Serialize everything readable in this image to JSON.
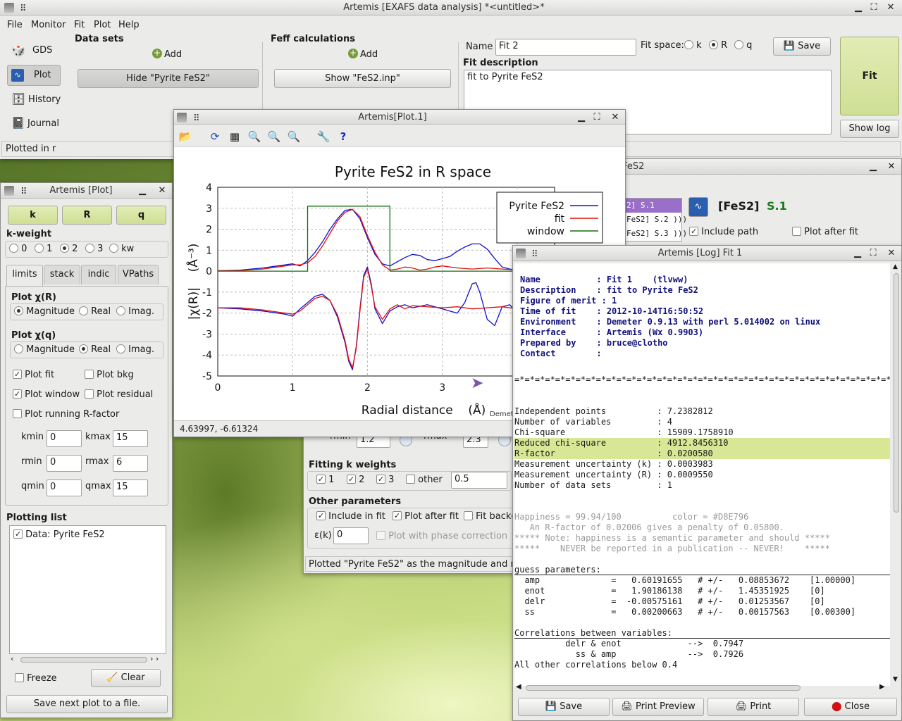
{
  "main": {
    "title": "Artemis [EXAFS data analysis] *<untitled>*",
    "menu": [
      "File",
      "Monitor",
      "Fit",
      "Plot",
      "Help"
    ],
    "side": [
      "GDS",
      "Plot",
      "History",
      "Journal"
    ],
    "data_sets_label": "Data sets",
    "add": "Add",
    "hide_btn": "Hide \"Pyrite FeS2\"",
    "feff_label": "Feff calculations",
    "show_btn": "Show \"FeS2.inp\"",
    "name_label": "Name",
    "name_value": "Fit 2",
    "fitspace_label": "Fit space:",
    "fitspace_opts": [
      "k",
      "R",
      "q"
    ],
    "save": "Save",
    "fit_btn": "Fit",
    "desc_label": "Fit description",
    "desc_value": "fit to Pyrite FeS2",
    "showlog": "Show log",
    "status": "Plotted in r"
  },
  "plotctl": {
    "title": "Artemis [Plot]",
    "kbtn": "k",
    "rbtn": "R",
    "qbtn": "q",
    "kweight_label": "k-weight",
    "kweights": [
      "0",
      "1",
      "2",
      "3",
      "kw"
    ],
    "tabs": [
      "limits",
      "stack",
      "indic",
      "VPaths"
    ],
    "plot_r_label": "Plot χ(R)",
    "plot_r_opts": [
      "Magnitude",
      "Real",
      "Imag."
    ],
    "plot_q_label": "Plot χ(q)",
    "plot_q_opts": [
      "Magnitude",
      "Real",
      "Imag."
    ],
    "plotfit": "Plot fit",
    "plotbkg": "Plot bkg",
    "plotwindow": "Plot window",
    "plotresid": "Plot residual",
    "plotrunning": "Plot running R-factor",
    "kmin_l": "kmin",
    "kmin": "0",
    "kmax_l": "kmax",
    "kmax": "15",
    "rmin_l": "rmin",
    "rmin": "0",
    "rmax_l": "rmax",
    "rmax": "6",
    "qmin_l": "qmin",
    "qmin": "0",
    "qmax_l": "qmax",
    "qmax": "15",
    "plotlist_label": "Plotting list",
    "plotlist_item": "Data: Pyrite FeS2",
    "freeze": "Freeze",
    "clear": "Clear",
    "savenext": "Save next plot to a file."
  },
  "plot1": {
    "title": "Artemis[Plot.1]",
    "coords": "4.63997, -6.61324"
  },
  "chart_data": {
    "type": "line",
    "title": "Pyrite FeS2 in R space",
    "xlabel": "Radial distance    (Å)",
    "ylabel": "|χ(R)|    (Å⁻³)",
    "xlim": [
      0,
      4.5
    ],
    "ylim": [
      -5,
      4
    ],
    "xticks": [
      "0",
      "1",
      "2",
      "3",
      "4"
    ],
    "yticks": [
      "4",
      "3",
      "2",
      "1",
      "0",
      "-1",
      "-2",
      "-3",
      "-4",
      "-5"
    ],
    "grid": true,
    "legend_position": "top-right",
    "footer": "Demete",
    "series": [
      {
        "name": "Pyrite FeS2",
        "color": "#1010d0",
        "x": [
          0,
          0.3,
          0.6,
          0.9,
          1.0,
          1.1,
          1.2,
          1.3,
          1.4,
          1.5,
          1.6,
          1.7,
          1.8,
          1.9,
          2.0,
          2.1,
          2.2,
          2.3,
          2.4,
          2.5,
          2.6,
          2.7,
          2.8,
          2.9,
          3.0,
          3.1,
          3.2,
          3.3,
          3.4,
          3.5,
          3.6,
          3.7,
          3.8,
          3.9,
          4.0,
          4.1,
          4.2,
          4.3,
          4.5
        ],
        "y": [
          0.02,
          0.05,
          0.15,
          0.3,
          0.35,
          0.25,
          0.5,
          0.9,
          1.4,
          2.0,
          2.5,
          2.9,
          2.95,
          2.5,
          1.6,
          0.8,
          0.35,
          0.25,
          0.45,
          0.65,
          0.8,
          0.75,
          0.55,
          0.5,
          0.6,
          0.7,
          0.95,
          1.15,
          1.3,
          1.3,
          1.05,
          0.6,
          0.2,
          0.1,
          0.05,
          0.05,
          0.03,
          0.02,
          0.01
        ]
      },
      {
        "name": "fit",
        "color": "#e01010",
        "x": [
          0,
          0.3,
          0.6,
          0.9,
          1.0,
          1.1,
          1.2,
          1.3,
          1.4,
          1.5,
          1.6,
          1.7,
          1.8,
          1.9,
          2.0,
          2.1,
          2.2,
          2.3,
          2.4,
          2.5,
          2.6,
          2.7,
          2.8,
          2.9,
          3.0,
          3.2,
          3.4,
          3.6,
          3.8,
          4.0,
          4.2,
          4.5
        ],
        "y": [
          0.02,
          0.03,
          0.1,
          0.25,
          0.3,
          0.3,
          0.4,
          0.7,
          1.2,
          1.8,
          2.4,
          2.8,
          2.95,
          2.6,
          1.7,
          0.9,
          0.3,
          0.05,
          0.1,
          0.2,
          0.15,
          0.05,
          0.1,
          0.2,
          0.25,
          0.15,
          0.1,
          0.15,
          0.1,
          0.05,
          0.05,
          0.03
        ]
      },
      {
        "name": "window",
        "color": "#107010",
        "x": [
          0,
          1.2,
          1.2,
          2.3,
          2.3,
          4.5
        ],
        "y": [
          0,
          0,
          3.1,
          3.1,
          0,
          0
        ]
      },
      {
        "name": "",
        "color": "#1010d0",
        "x": [
          0,
          0.3,
          0.6,
          0.9,
          1.0,
          1.1,
          1.2,
          1.3,
          1.4,
          1.5,
          1.6,
          1.7,
          1.75,
          1.8,
          1.85,
          1.9,
          1.95,
          2.0,
          2.05,
          2.1,
          2.2,
          2.3,
          2.4,
          2.5,
          2.6,
          2.8,
          3.0,
          3.1,
          3.2,
          3.3,
          3.4,
          3.45,
          3.5,
          3.6,
          3.7,
          3.8,
          3.9,
          4.0,
          4.1,
          4.2,
          4.5
        ],
        "y": [
          -1.75,
          -1.8,
          -1.9,
          -2.05,
          -2.15,
          -1.8,
          -1.5,
          -1.2,
          -1.1,
          -1.4,
          -2.2,
          -3.4,
          -4.3,
          -4.7,
          -3.6,
          -1.8,
          -0.2,
          0.2,
          -0.6,
          -1.8,
          -2.5,
          -1.9,
          -1.7,
          -1.6,
          -1.75,
          -1.6,
          -1.8,
          -1.9,
          -2.0,
          -1.5,
          -0.6,
          -0.55,
          -1.0,
          -2.3,
          -2.6,
          -1.7,
          -1.6,
          -2.0,
          -1.9,
          -1.7,
          -1.8
        ]
      },
      {
        "name": "",
        "color": "#e01010",
        "x": [
          0,
          0.3,
          0.6,
          0.9,
          1.0,
          1.1,
          1.2,
          1.3,
          1.4,
          1.5,
          1.6,
          1.7,
          1.75,
          1.8,
          1.85,
          1.9,
          1.95,
          2.0,
          2.05,
          2.1,
          2.2,
          2.3,
          2.4,
          2.5,
          2.6,
          2.8,
          3.0,
          3.2,
          3.4,
          3.6,
          3.8,
          4.0,
          4.2,
          4.5
        ],
        "y": [
          -1.75,
          -1.75,
          -1.85,
          -2.0,
          -2.05,
          -1.9,
          -1.6,
          -1.3,
          -1.2,
          -1.4,
          -2.1,
          -3.3,
          -4.2,
          -4.6,
          -3.7,
          -1.9,
          -0.3,
          0.1,
          -0.7,
          -1.7,
          -2.3,
          -1.8,
          -1.6,
          -1.8,
          -1.65,
          -1.7,
          -1.75,
          -1.7,
          -1.8,
          -1.75,
          -1.7,
          -1.8,
          -1.75,
          -1.75
        ]
      }
    ]
  },
  "fitwin": {
    "title_suffix": "e FeS2",
    "paths": [
      "2] S.1",
      "FeS2] S.2 )))",
      "FeS2] S.3 )))"
    ],
    "path_name": "[FeS2]",
    "path_id": "S.1",
    "include_path": "Include path",
    "plot_after": "Plot after fit",
    "rmin": "1.2",
    "rmax": "2.3",
    "rmin_l": "rmin",
    "rmax_l": "rmax",
    "kweights_label": "Fitting k weights",
    "kw1": "1",
    "kw2": "2",
    "kw3": "3",
    "other": "other",
    "other_val": "0.5",
    "otherparams_label": "Other parameters",
    "include_fit": "Include in fit",
    "plot_after_fit": "Plot after fit",
    "fit_bkg": "Fit backg",
    "eps_label": "ε(k)",
    "eps_val": "0",
    "phase_corr": "Plot with phase correction",
    "status": "Plotted \"Pyrite FeS2\" as the magnitude and real pa"
  },
  "log": {
    "title": "Artemis [Log] Fit 1",
    "header": [
      "Name           : Fit 1    (tlvww)",
      "Description    : fit to Pyrite FeS2",
      "Figure of merit : 1",
      "Time of fit    : 2012-10-14T16:50:52",
      "Environment    : Demeter 0.9.13 with perl 5.014002 on linux",
      "Interface      : Artemis (Wx 0.9903)",
      "Prepared by    : bruce@clotho",
      "Contact        :"
    ],
    "stars": "=*=*=*=*=*=*=*=*=*=*=*=*=*=*=*=*=*=*=*=*=*=*=*=*=*=*=*=*=*=*=*=*=*=*=*=*=*",
    "stats": [
      "Independent points          : 7.2382812",
      "Number of variables         : 4",
      "Chi-square                  : 15909.1758910",
      "Reduced chi-square          : 4912.8456310",
      "R-factor                    : 0.0200580",
      "Measurement uncertainty (k) : 0.0003983",
      "Measurement uncertainty (R) : 0.0009550",
      "Number of data sets         : 1"
    ],
    "happy": [
      "Happiness = 99.94/100          color = #D8E796",
      "   An R-factor of 0.02006 gives a penalty of 0.05800.",
      "***** Note: happiness is a semantic parameter and should *****",
      "*****    NEVER be reported in a publication -- NEVER!    *****"
    ],
    "guess_label": "guess parameters:",
    "guess": [
      "  amp              =   0.60191655   # +/-   0.08853672    [1.00000]",
      "  enot             =   1.90186138   # +/-   1.45351925    [0]",
      "  delr             =  -0.00575161   # +/-   0.01253567    [0]",
      "  ss               =   0.00200663   # +/-   0.00157563    [0.00300]"
    ],
    "corr_label": "Correlations between variables:",
    "corr": [
      "          delr & enot             -->  0.7947",
      "            ss & amp              -->  0.7926"
    ],
    "corr_footer": "All other correlations below 0.4",
    "save": "Save",
    "preview": "Print Preview",
    "print": "Print",
    "close": "Close"
  }
}
